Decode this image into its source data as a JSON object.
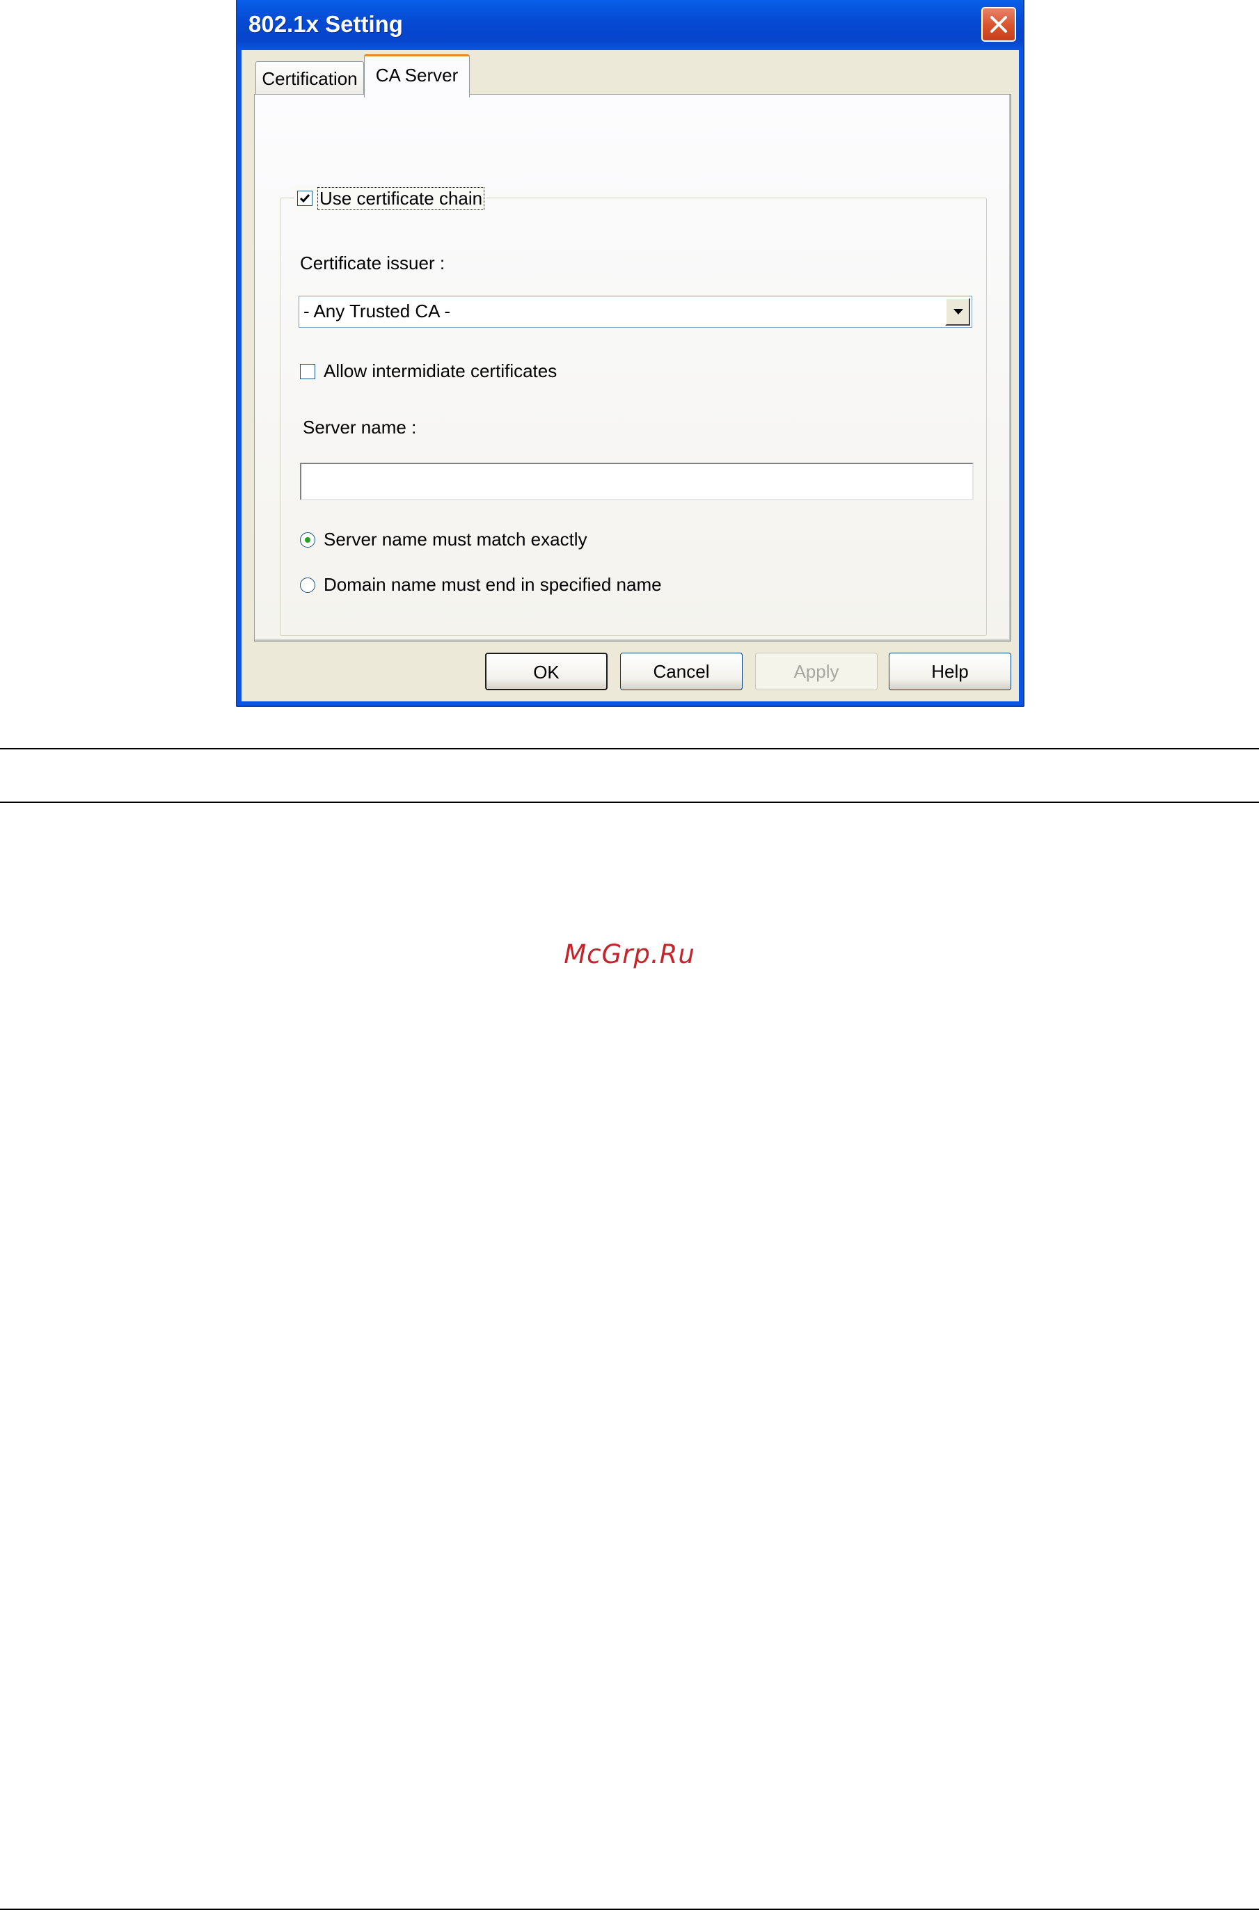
{
  "window": {
    "title": "802.1x Setting"
  },
  "tabs": [
    {
      "label": "Certification",
      "active": false
    },
    {
      "label": "CA Server",
      "active": true
    }
  ],
  "ca_server": {
    "use_chain_label": "Use certificate chain",
    "use_chain_checked": true,
    "issuer_label": "Certificate issuer :",
    "issuer_value": "- Any Trusted CA -",
    "allow_intermediate_label": "Allow intermidiate certificates",
    "allow_intermediate_checked": false,
    "server_name_label": "Server name :",
    "server_name_value": "",
    "radio_exact_label": "Server name must match exactly",
    "radio_domain_label": "Domain name must end in specified name",
    "selected_radio": "exact"
  },
  "buttons": {
    "ok": "OK",
    "cancel": "Cancel",
    "apply": "Apply",
    "help": "Help"
  },
  "page": {
    "watermark": "McGrp.Ru"
  },
  "colors": {
    "title_bar": "#0a55e2",
    "dialog_face": "#ece9d8",
    "watermark": "#c4242b",
    "check_green": "#21a121"
  }
}
